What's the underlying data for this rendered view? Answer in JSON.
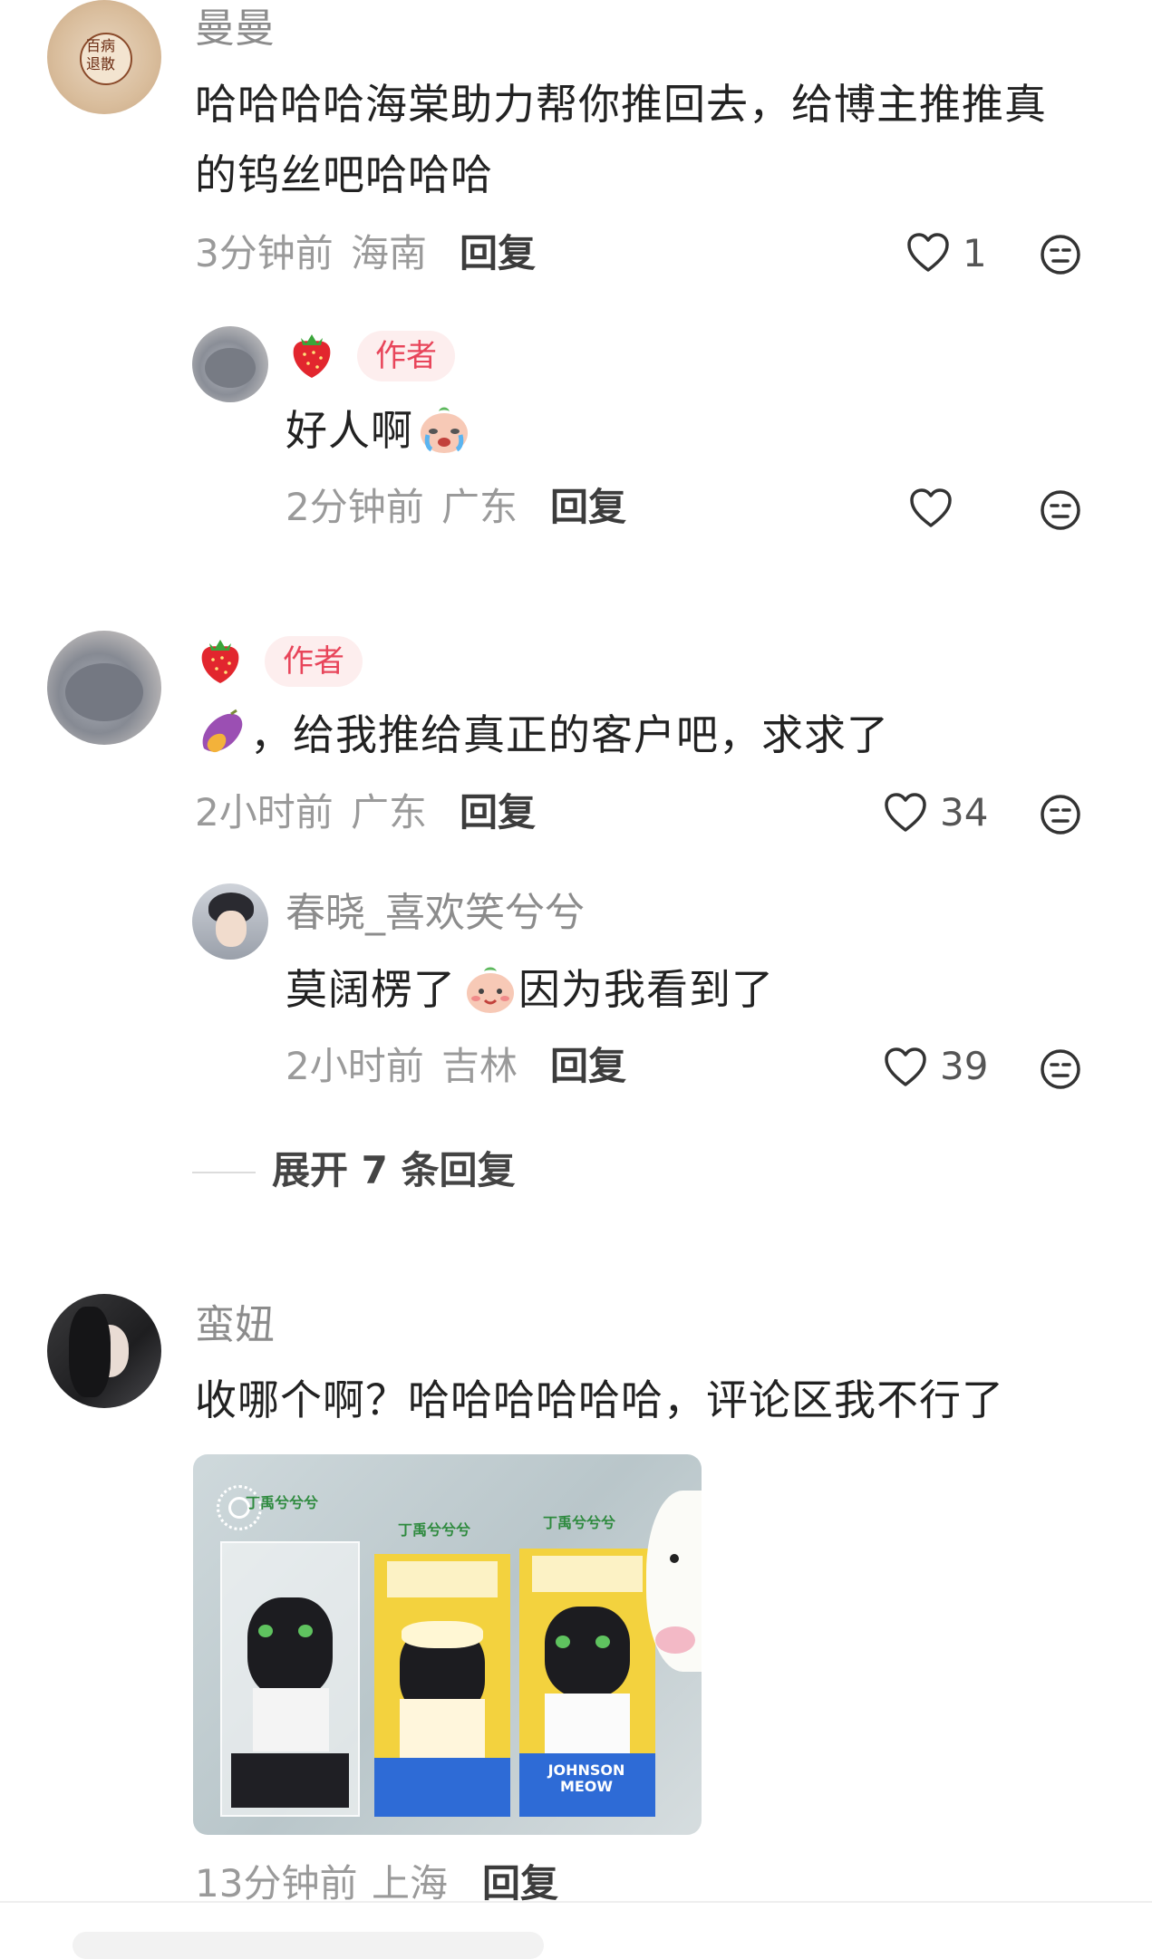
{
  "comments": [
    {
      "user": "曼曼",
      "text_line1": "哈哈哈哈海棠助力帮你推回去，给博主推推真",
      "text_line2": "的钨丝吧哈哈哈",
      "time": "3分钟前",
      "location": "海南",
      "reply_label": "回复",
      "likes": "1",
      "avatar_text": "百病",
      "avatar_text2": "退散"
    },
    {
      "user_badge": "作者",
      "text": "好人啊",
      "time": "2分钟前",
      "location": "广东",
      "reply_label": "回复"
    },
    {
      "user_badge": "作者",
      "text": "，给我推给真正的客户吧，求求了",
      "time": "2小时前",
      "location": "广东",
      "reply_label": "回复",
      "likes": "34"
    },
    {
      "user": "春晓_喜欢笑兮兮",
      "text_before": "莫阔楞了",
      "text_after": "因为我看到了",
      "time": "2小时前",
      "location": "吉林",
      "reply_label": "回复",
      "likes": "39"
    },
    {
      "user": "蛮妞",
      "text": "收哪个啊？哈哈哈哈哈哈，评论区我不行了",
      "time": "13分钟前",
      "location": "上海",
      "reply_label": "回复",
      "image_labels": [
        "丁禹兮兮兮",
        "JOHNSON MEOW"
      ]
    }
  ],
  "expand_replies": "展开 7 条回复",
  "colors": {
    "accent_red": "#e8455a",
    "badge_bg": "#fdeeee",
    "meta_gray": "#9a9a9a"
  }
}
